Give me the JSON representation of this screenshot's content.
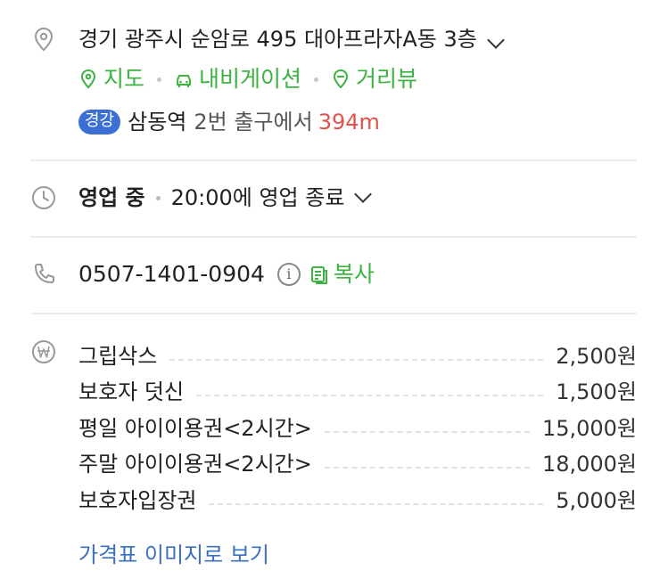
{
  "address": {
    "text": "경기 광주시 순암로 495 대아프라자A동 3층",
    "links": [
      {
        "label": "지도",
        "icon": "map-pin-icon"
      },
      {
        "label": "내비게이션",
        "icon": "car-icon"
      },
      {
        "label": "거리뷰",
        "icon": "street-view-icon"
      }
    ],
    "subway": {
      "line_badge": "경강",
      "line_color": "#3b6fd6",
      "station": "삼동역",
      "exit_text": "2번 출구에서",
      "distance": "394m"
    }
  },
  "hours": {
    "status": "영업 중",
    "detail": "20:00에 영업 종료"
  },
  "phone": {
    "number": "0507-1401-0904",
    "info_glyph": "i",
    "copy_label": "복사"
  },
  "prices": {
    "items": [
      {
        "name": "그립삭스",
        "price": "2,500원"
      },
      {
        "name": "보호자 덧신",
        "price": "1,500원"
      },
      {
        "name": "평일 아이이용권<2시간>",
        "price": "15,000원"
      },
      {
        "name": "주말 아이이용권<2시간>",
        "price": "18,000원"
      },
      {
        "name": "보호자입장권",
        "price": "5,000원"
      }
    ],
    "more_link": "가격표 이미지로 보기",
    "currency_icon": "won-icon"
  },
  "colors": {
    "green": "#3db341",
    "distance_red": "#e0524c",
    "link_blue": "#3a6fc4"
  }
}
